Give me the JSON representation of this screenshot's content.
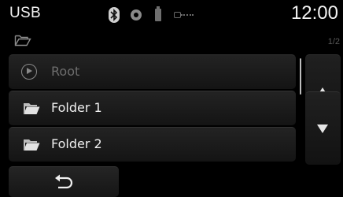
{
  "status_bar": {
    "source_label": "USB",
    "time": "12:00",
    "icons": [
      "bluetooth-icon",
      "disc-icon",
      "usb-device-icon",
      "cable-icon"
    ],
    "bluetooth_glyph": "∗"
  },
  "path_bar": {
    "folder_icon": "open-folder-icon",
    "page_indicator": "1/2"
  },
  "list": {
    "items": [
      {
        "label": "Root",
        "icon": "play-circle-icon",
        "enabled": false
      },
      {
        "label": "Folder 1",
        "icon": "folder-icon",
        "enabled": true
      },
      {
        "label": "Folder 2",
        "icon": "folder-icon",
        "enabled": true
      }
    ]
  },
  "controls": {
    "scroll_up_icon": "triangle-up-icon",
    "scroll_down_icon": "triangle-down-icon",
    "back_icon": "back-arrow-icon"
  },
  "colors": {
    "background": "#000000",
    "button": "#1c1c1c",
    "text": "#f0f0f0",
    "disabled_text": "#6d6d6d"
  }
}
